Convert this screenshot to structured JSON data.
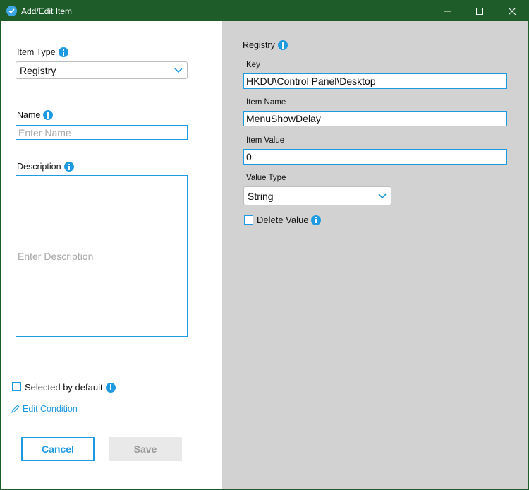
{
  "window": {
    "title": "Add/Edit Item",
    "controls": [
      "minimize-icon",
      "maximize-icon",
      "close-icon"
    ]
  },
  "left": {
    "item_type_label": "Item Type",
    "item_type_value": "Registry",
    "name_label": "Name",
    "name_placeholder": "Enter Name",
    "description_label": "Description",
    "description_placeholder": "Enter Description",
    "selected_by_default_label": "Selected by default",
    "selected_by_default_checked": false,
    "edit_condition_label": "Edit Condition",
    "cancel_label": "Cancel",
    "save_label": "Save"
  },
  "right": {
    "section_title": "Registry",
    "key_label": "Key",
    "key_value": "HKDU\\Control Panel\\Desktop",
    "item_name_label": "Item Name",
    "item_name_value": "MenuShowDelay",
    "item_value_label": "Item Value",
    "item_value_value": "0",
    "value_type_label": "Value Type",
    "value_type_value": "String",
    "delete_value_label": "Delete Value",
    "delete_value_checked": false
  },
  "colors": {
    "titlebar": "#1e5c2a",
    "accent": "#1e9ae0",
    "gray_panel": "#d2d2d2"
  }
}
